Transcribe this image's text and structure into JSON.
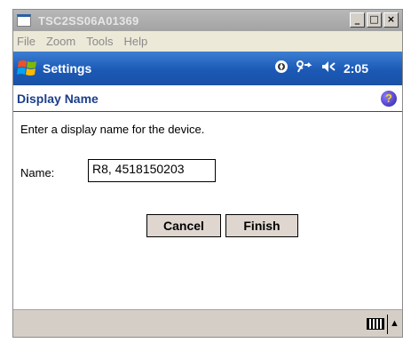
{
  "window": {
    "title": "TSC2SS06A01369",
    "controls": {
      "minimize": "_",
      "maximize": "□",
      "close": "×"
    }
  },
  "menubar": {
    "items": [
      "File",
      "Zoom",
      "Tools",
      "Help"
    ]
  },
  "navbar": {
    "title": "Settings",
    "start_icon": "windows-flag-icon",
    "status_icons": [
      "sync-icon",
      "connectivity-icon",
      "volume-icon"
    ],
    "time": "2:05"
  },
  "page": {
    "title": "Display Name",
    "help_icon": "help-icon"
  },
  "form": {
    "instruction": "Enter a display name for the device.",
    "name_label": "Name:",
    "name_value": "R8, 4518150203"
  },
  "buttons": {
    "cancel": "Cancel",
    "finish": "Finish"
  },
  "bottombar": {
    "keyboard_icon": "keyboard-icon",
    "arrow": "▲"
  }
}
